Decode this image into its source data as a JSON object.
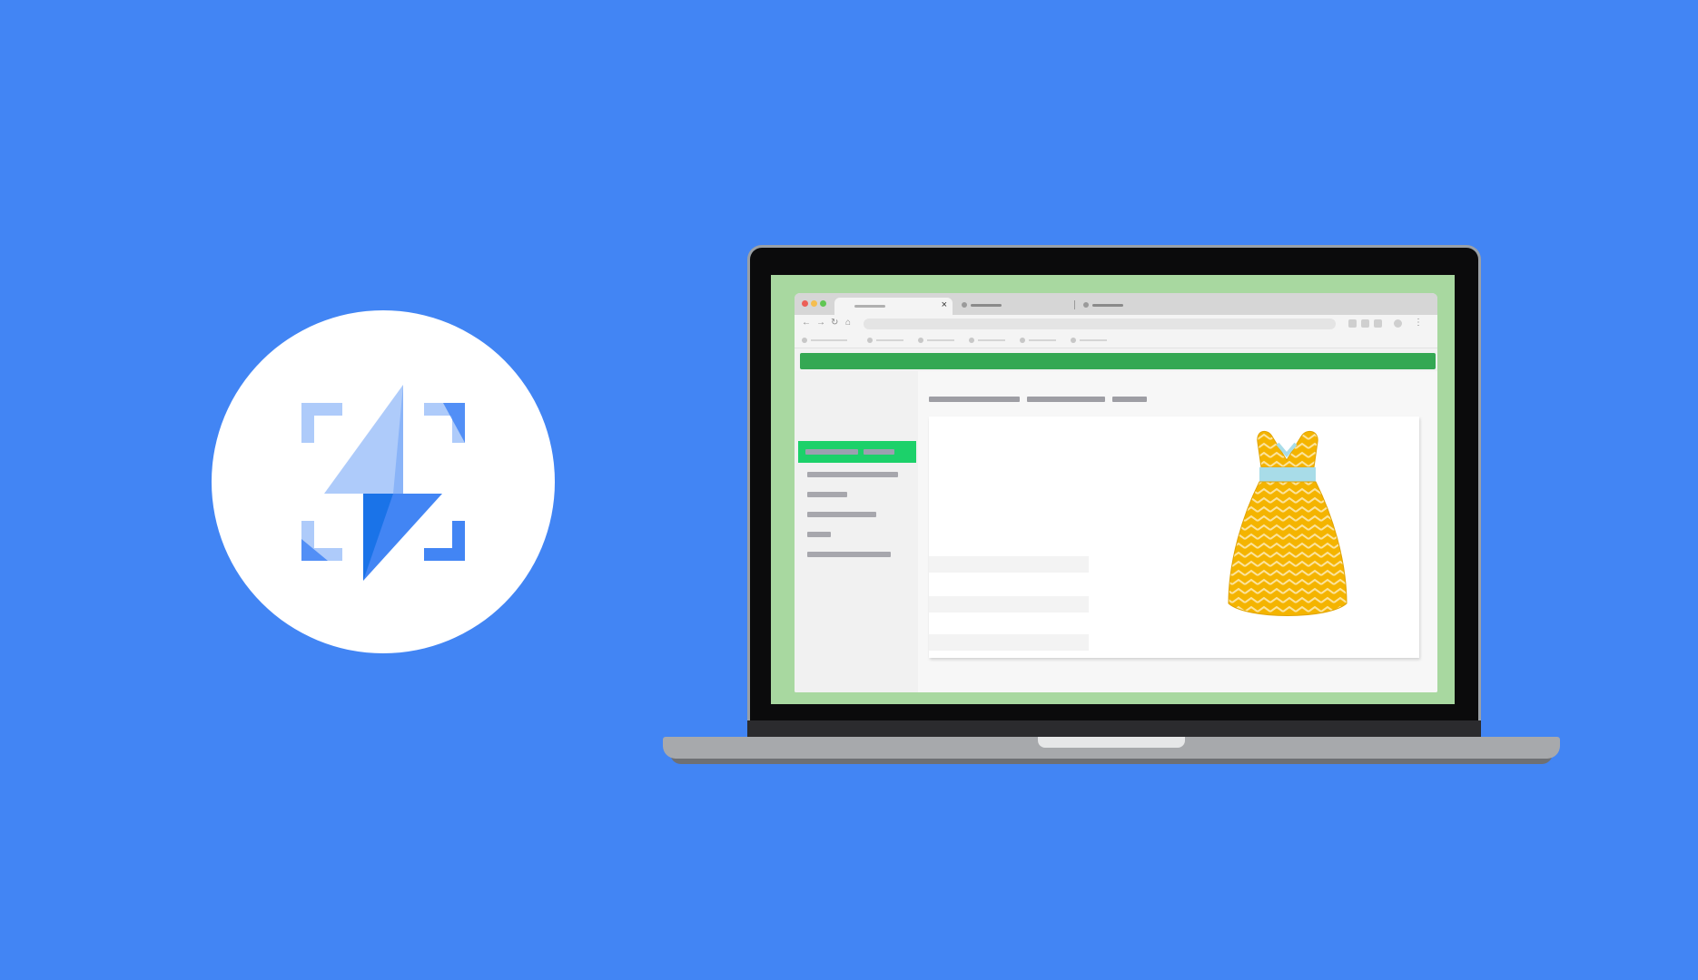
{
  "colors": {
    "background": "#4285F4",
    "circle": "#FFFFFF",
    "bolt_light": "#AECBFA",
    "bolt_dark": "#4285F4",
    "screen_frame": "#A8D8A0",
    "page_header": "#34A853",
    "sidebar_active": "#1CD16A",
    "dress_yellow": "#F4B400",
    "dress_waist": "#A8DCE8"
  },
  "logo": {
    "icon": "lightning-bolt-focus-icon"
  },
  "laptop": {
    "browser": {
      "tabs": [
        {
          "state": "active",
          "has_close": true,
          "close_glyph": "×"
        },
        {
          "state": "inactive"
        },
        {
          "state": "inactive"
        }
      ],
      "nav_glyphs": [
        "←",
        "→",
        "↻",
        "⌂"
      ],
      "bookmark_count": 6
    },
    "page": {
      "sidebar_items": 6,
      "active_sidebar_index": 0,
      "product": {
        "image": "yellow-dress-icon"
      }
    }
  }
}
